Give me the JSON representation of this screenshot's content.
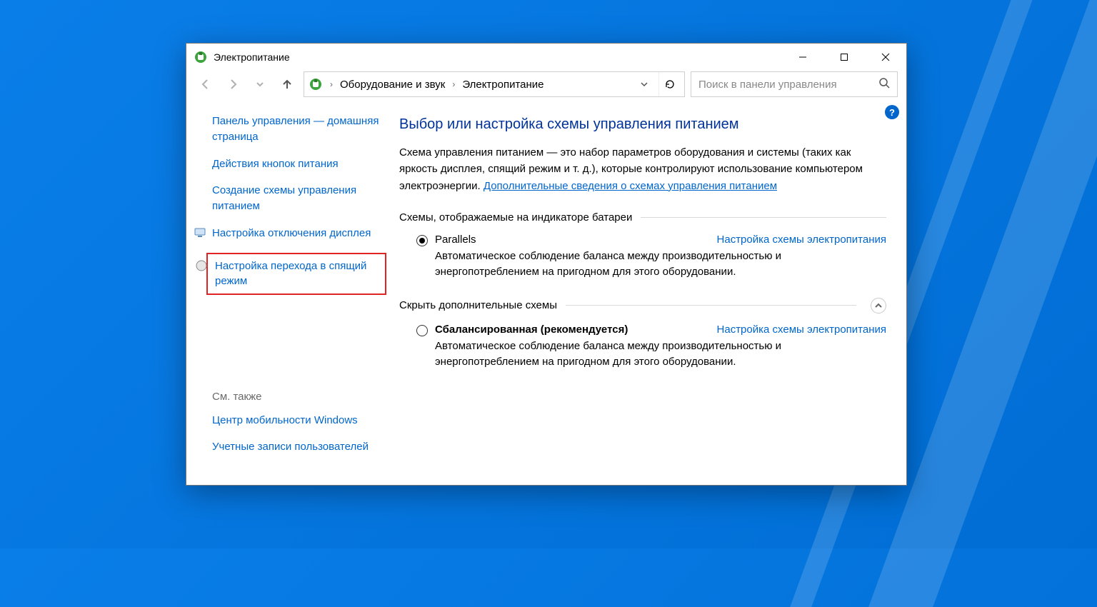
{
  "window": {
    "title": "Электропитание"
  },
  "breadcrumb": {
    "level1": "Оборудование и звук",
    "level2": "Электропитание"
  },
  "search": {
    "placeholder": "Поиск в панели управления"
  },
  "sidebar": {
    "home": "Панель управления — домашняя страница",
    "links": [
      "Действия кнопок питания",
      "Создание схемы управления питанием",
      "Настройка отключения дисплея",
      "Настройка перехода в спящий режим"
    ],
    "see_also_head": "См. также",
    "see_also": [
      "Центр мобильности Windows",
      "Учетные записи пользователей"
    ]
  },
  "main": {
    "heading": "Выбор или настройка схемы управления питанием",
    "desc_pre": "Схема управления питанием — это набор параметров оборудования и системы (таких как яркость дисплея, спящий режим и т. д.), которые контролируют использование компьютером электроэнергии. ",
    "desc_link": "Дополнительные сведения о схемах управления питанием",
    "group1_title": "Схемы, отображаемые на индикаторе батареи",
    "group2_title": "Скрыть дополнительные схемы",
    "plan_link": "Настройка схемы электропитания",
    "plan1": {
      "name": "Parallels",
      "desc": "Автоматическое соблюдение баланса между производительностью и энергопотреблением на пригодном для этого оборудовании."
    },
    "plan2": {
      "name": "Сбалансированная (рекомендуется)",
      "desc": "Автоматическое соблюдение баланса между производительностью и энергопотреблением на пригодном для этого оборудовании."
    }
  },
  "help": "?"
}
